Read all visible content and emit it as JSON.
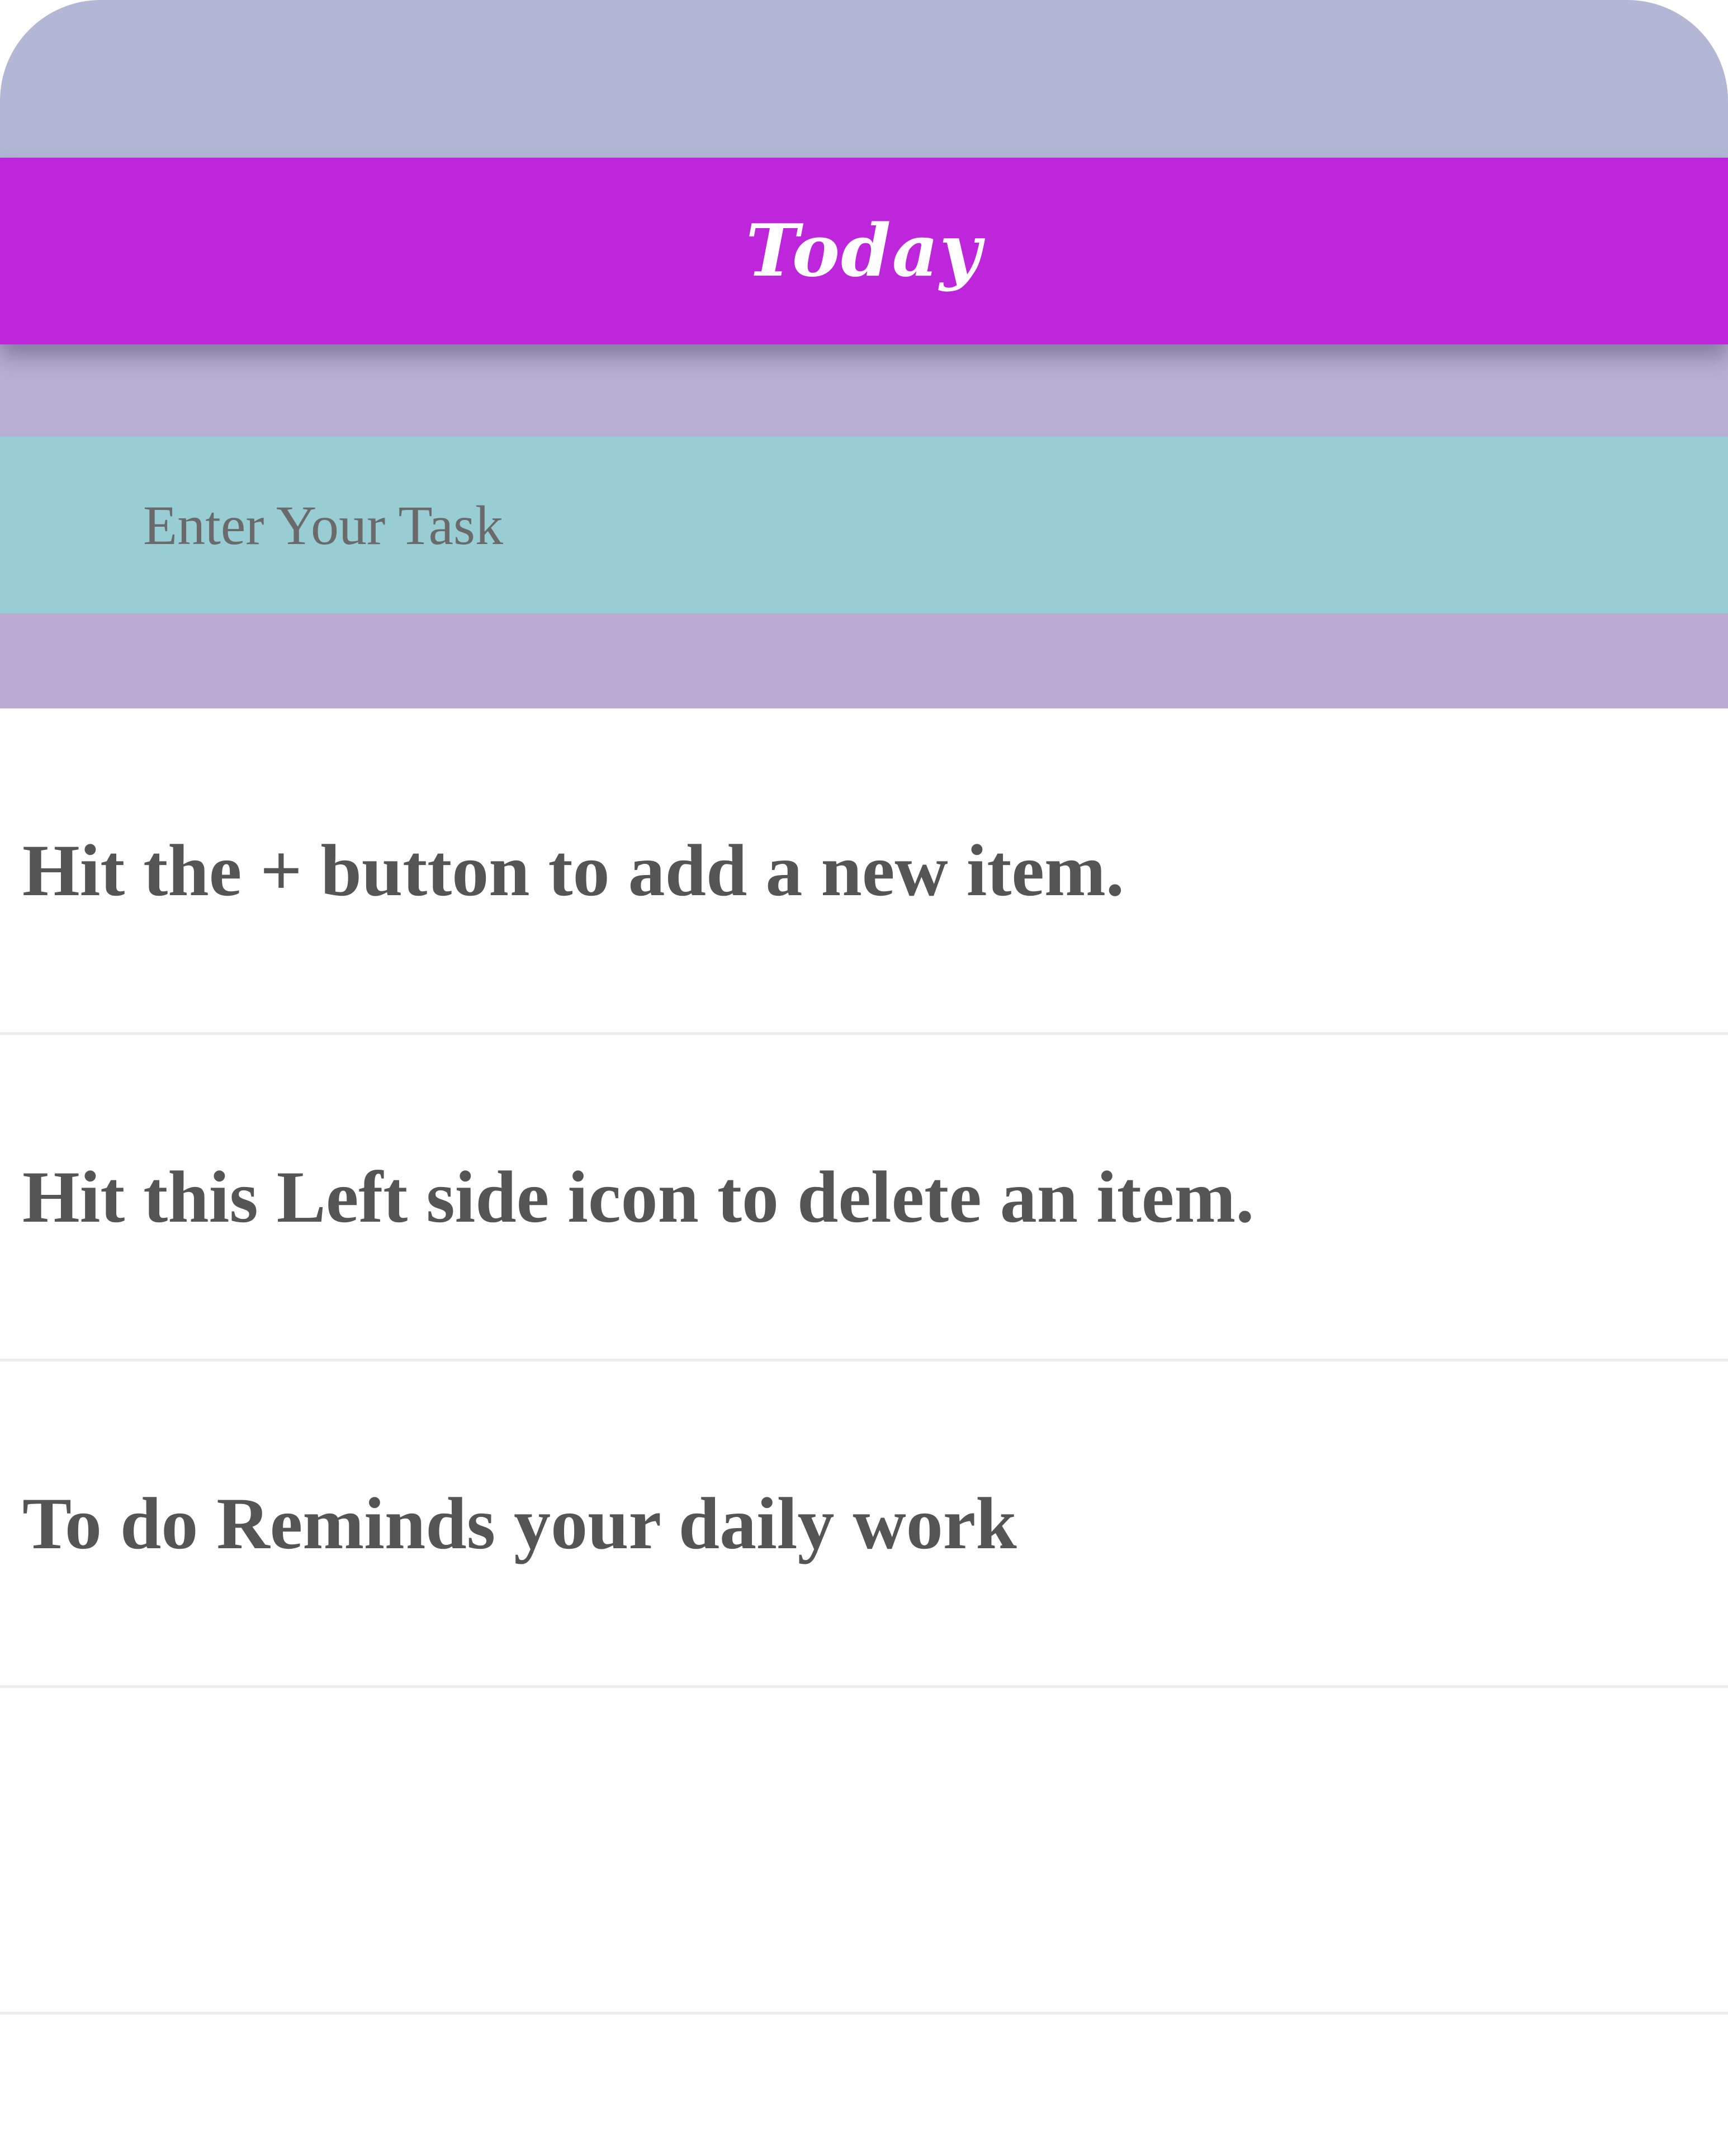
{
  "header": {
    "title": "Today"
  },
  "input": {
    "placeholder": "Enter Your Task",
    "value": ""
  },
  "tasks": [
    {
      "text": "Hit the + button to add a new item."
    },
    {
      "text": "Hit this Left side icon to delete an item."
    },
    {
      "text": "To do Reminds your daily work"
    },
    {
      "text": ""
    }
  ],
  "colors": {
    "header_bg": "#be26dc",
    "top_band": "#b3b7d6",
    "input_bg": "#98cdd3",
    "lower_band": "#bdaad3",
    "task_text": "#555555"
  }
}
